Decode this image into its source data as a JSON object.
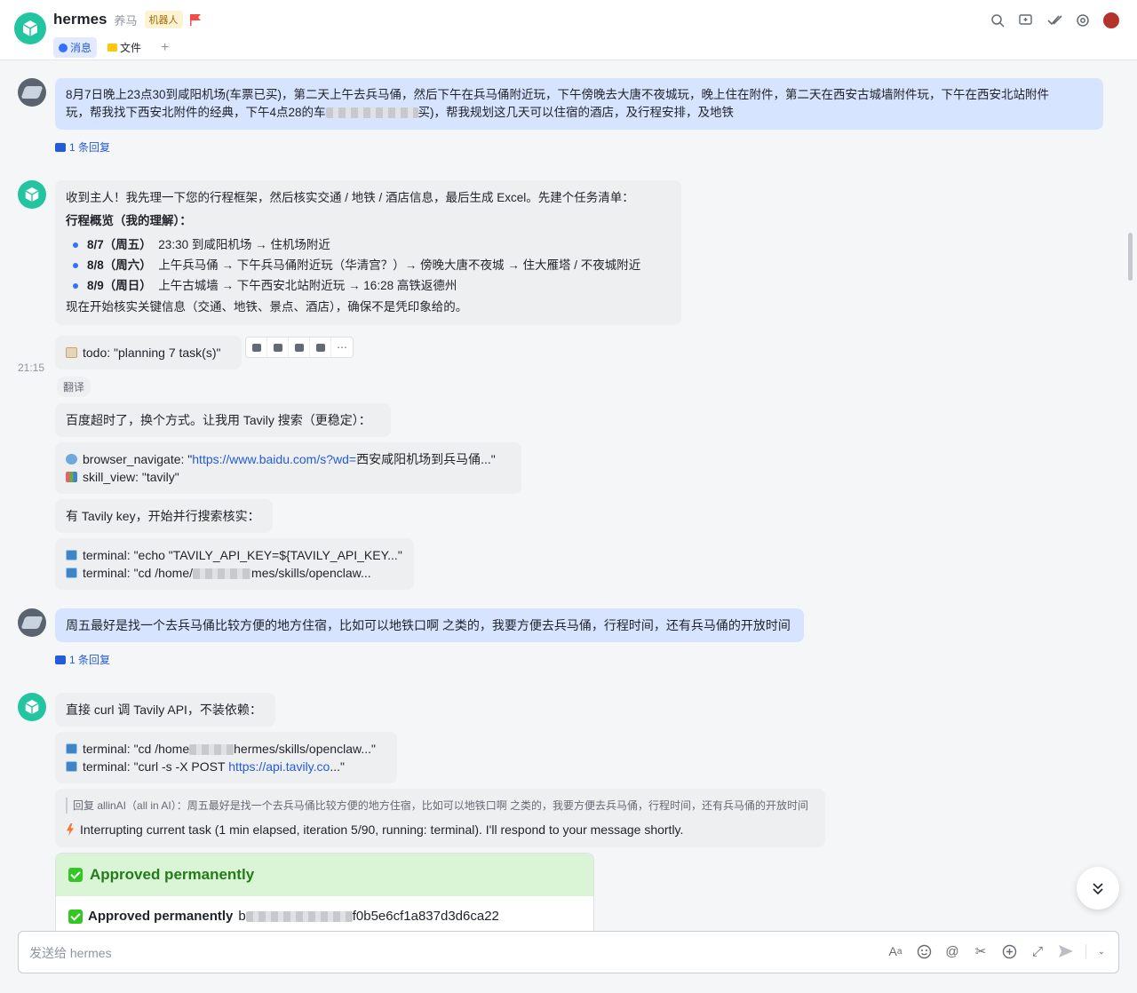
{
  "header": {
    "title": "hermes",
    "alias": "养马",
    "bot_tag": "机器人",
    "tabs": [
      {
        "label": "消息",
        "active": true
      },
      {
        "label": "文件",
        "active": false
      }
    ],
    "add_tab": "+"
  },
  "messages": {
    "m1": {
      "text_a": "8月7日晚上23点30到咸阳机场(车票已买)，第二天上午去兵马俑，然后下午在兵马俑附近玩，下午傍晚去大唐不夜城玩，晚上住在附件，第二天在西安古城墙附件玩，下午在西安北站附件",
      "text_b1": "玩，帮我找下西安北附件的经典，下午4点28的车",
      "text_b2": "买)，帮我规划这几天可以住宿的酒店，及行程安排，及地铁",
      "reply": "1 条回复"
    },
    "m2": {
      "intro": "收到主人！我先理一下您的行程框架，然后核实交通 / 地铁 / 酒店信息，最后生成 Excel。先建个任务清单：",
      "heading": "行程概览（我的理解）：",
      "items": [
        {
          "day": "8/7（周五）",
          "text": "23:30 到咸阳机场 → 住机场附近"
        },
        {
          "day": "8/8（周六）",
          "text": "上午兵马俑 → 下午兵马俑附近玩（华清宫？）→ 傍晚大唐不夜城 → 住大雁塔 / 不夜城附近"
        },
        {
          "day": "8/9（周日）",
          "text": "上午古城墙 → 下午西安北站附近玩 → 16:28 高铁返德州"
        }
      ],
      "outro": "现在开始核实关键信息（交通、地铁、景点、酒店），确保不是凭印象给的。"
    },
    "todo": "todo: \"planning 7 task(s)\"",
    "time": "21:15",
    "translate": "翻译",
    "m3": "百度超时了，换个方式。让我用 Tavily 搜索（更稳定）：",
    "tool1": {
      "nav_prefix": "browser_navigate: \"",
      "nav_link": "https://www.baidu.com/s?wd=",
      "nav_suffix": "西安咸阳机场到兵马俑...\"",
      "skill": "skill_view: \"tavily\""
    },
    "m4": "有 Tavily key，开始并行搜索核实：",
    "tool2": {
      "t1": "terminal: \"echo \"TAVILY_API_KEY=${TAVILY_API_KEY...\"",
      "t2a": "terminal: \"cd /home/",
      "t2b": "mes/skills/openclaw..."
    },
    "m5": {
      "text": "周五最好是找一个去兵马俑比较方便的地方住宿，比如可以地铁口啊 之类的，我要方便去兵马俑，行程时间，还有兵马俑的开放时间",
      "reply": "1 条回复"
    },
    "m6": "直接 curl 调 Tavily API，不装依赖：",
    "tool3": {
      "t1a": "terminal: \"cd /home",
      "t1b": "hermes/skills/openclaw...\"",
      "t2a": "terminal: \"curl -s -X POST ",
      "t2link": "https://api.tavily.co",
      "t2b": "...\""
    },
    "m7": {
      "quote": "回复 allinAI（all in AI）：周五最好是找一个去兵马俑比较方便的地方住宿，比如可以地铁口啊 之类的，我要方便去兵马俑，行程时间，还有兵马俑的开放时间",
      "text": "Interrupting current task (1 min elapsed, iteration 5/90, running: terminal). I'll respond to your message shortly."
    },
    "card": {
      "title": "Approved permanently",
      "body_prefix": "Approved permanently",
      "body_a": "b",
      "body_b": "f0b5e6cf1a837d3d6ca22"
    }
  },
  "composer": {
    "placeholder": "发送给 hermes"
  },
  "colors": {
    "accent": "#3370ff",
    "user_bubble": "#d6e4ff",
    "bot_bubble": "#eeeff1",
    "approved_green": "#34c724"
  }
}
